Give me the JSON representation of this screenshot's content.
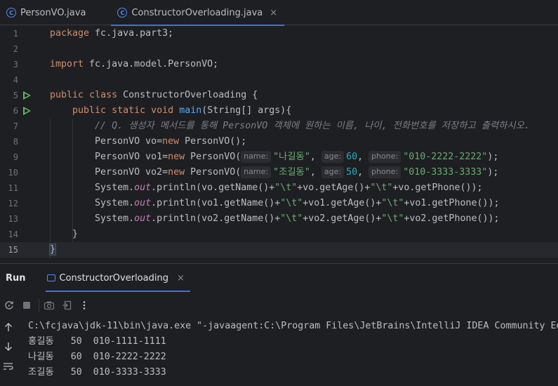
{
  "tabs": [
    {
      "label": "PersonVO.java",
      "icon": "class-icon",
      "active": false
    },
    {
      "label": "ConstructorOverloading.java",
      "icon": "class-icon",
      "active": true,
      "close": "×"
    }
  ],
  "editor": {
    "line_numbers": [
      "1",
      "2",
      "3",
      "4",
      "5",
      "6",
      "7",
      "8",
      "9",
      "10",
      "11",
      "12",
      "13",
      "14",
      "15"
    ],
    "current_line": "15",
    "l1": {
      "kw": "package",
      "rest": " fc.java.part3;"
    },
    "l3": {
      "kw": "import",
      "rest": " fc.java.model.PersonVO;"
    },
    "l5": {
      "kw1": "public",
      "kw2": "class",
      "name": " ConstructorOverloading ",
      "brace": "{"
    },
    "l6": {
      "kw1": "public",
      "kw2": "static",
      "kw3": "void",
      "method": "main",
      "rest": "(String[] args){"
    },
    "l7": {
      "comment": "// Q. 생성자 메서드를 통해 PersonVO 객체에 원하는 이름, 나이, 전화번호를 저장하고 출력하시오."
    },
    "l8": {
      "a": "PersonVO vo=",
      "kw": "new",
      "b": " PersonVO();"
    },
    "l9": {
      "a": "PersonVO vo1=",
      "kw": "new",
      "b": " PersonVO(",
      "h1": "name:",
      "s1": "\"나길동\"",
      "c1": ", ",
      "h2": "age:",
      "n": "60",
      "c2": ", ",
      "h3": "phone:",
      "s2": "\"010-2222-2222\"",
      "e": ");"
    },
    "l10": {
      "a": "PersonVO vo2=",
      "kw": "new",
      "b": " PersonVO(",
      "h1": "name:",
      "s1": "\"조길동\"",
      "c1": ", ",
      "h2": "age:",
      "n": "50",
      "c2": ", ",
      "h3": "phone:",
      "s2": "\"010-3333-3333\"",
      "e": ");"
    },
    "l11": {
      "a": "System.",
      "out": "out",
      "b": ".println(vo.getName()+",
      "t1": "\"\\t\"",
      "c": "+vo.getAge()+",
      "t2": "\"\\t\"",
      "d": "+vo.getPhone());"
    },
    "l12": {
      "a": "System.",
      "out": "out",
      "b": ".println(vo1.getName()+",
      "t1": "\"\\t\"",
      "c": "+vo1.getAge()+",
      "t2": "\"\\t\"",
      "d": "+vo1.getPhone());"
    },
    "l13": {
      "a": "System.",
      "out": "out",
      "b": ".println(vo2.getName()+",
      "t1": "\"\\t\"",
      "c": "+vo2.getAge()+",
      "t2": "\"\\t\"",
      "d": "+vo2.getPhone());"
    },
    "l14": "}",
    "l15": "}"
  },
  "run": {
    "title": "Run",
    "tab_label": "ConstructorOverloading",
    "tab_close": "×",
    "console": [
      "C:\\fcjava\\jdk-11\\bin\\java.exe \"-javaagent:C:\\Program Files\\JetBrains\\IntelliJ IDEA Community Ed",
      "홍길동   50  010-1111-1111",
      "나길동   60  010-2222-2222",
      "조길동   50  010-3333-3333"
    ]
  }
}
